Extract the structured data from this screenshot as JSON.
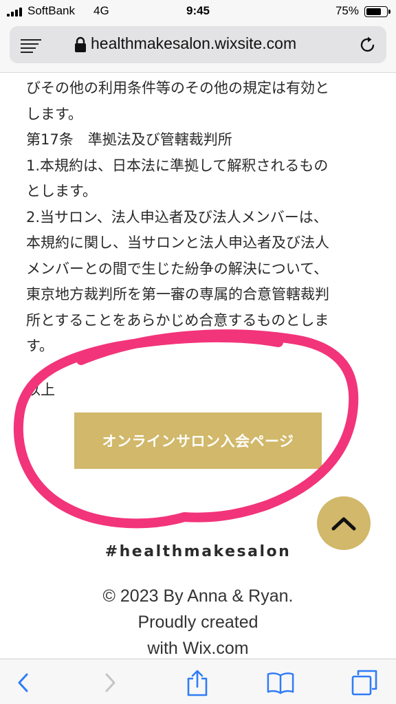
{
  "status_bar": {
    "carrier": "SoftBank",
    "network": "4G",
    "time": "9:45",
    "battery_percent": "75%",
    "battery_level": 0.75
  },
  "browser": {
    "url": "healthmakesalon.wixsite.com",
    "icons": [
      "reader-mode-icon",
      "lock-icon",
      "reload-icon"
    ]
  },
  "article": {
    "lines": [
      "びその他の利用条件等のその他の規定は有効と",
      "します。",
      "第17条　準拠法及び管轄裁判所",
      "1.本規約は、日本法に準拠して解釈されるもの",
      "とします。",
      "2.当サロン、法人申込者及び法人メンバーは、",
      "本規約に関し、当サロンと法人申込者及び法人",
      "メンバーとの間で生じた紛争の解決について、",
      "東京地方裁判所を第一審の専属的合意管轄裁判",
      "所とすることをあらかじめ合意するものとしま",
      "す。"
    ],
    "ending": "以上"
  },
  "join_button": {
    "label": "オンラインサロン入会ページ"
  },
  "back_to_top": {
    "icon": "chevron-up-icon"
  },
  "footer": {
    "hashtag": "#healthmakesalon",
    "copyright": "© 2023 By Anna & Ryan.",
    "credit_line1": "Proudly created",
    "credit_line2": "with Wix.com"
  },
  "colors": {
    "accent_gold": "#d1b86a",
    "annotation_pink": "#f2347a",
    "ios_blue": "#2f7cf6"
  },
  "toolbar": {
    "icons": [
      "back-icon",
      "forward-icon",
      "share-icon",
      "bookmarks-icon",
      "tabs-icon"
    ]
  }
}
